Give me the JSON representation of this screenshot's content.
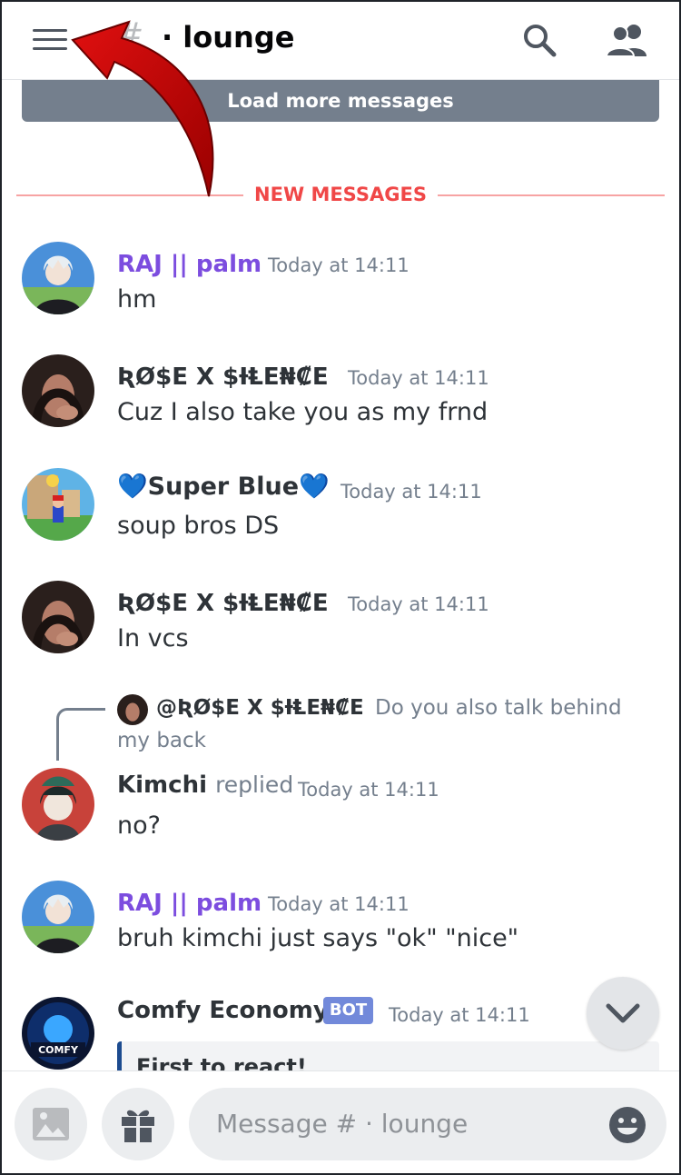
{
  "header": {
    "hash": "#",
    "channel": "· lounge"
  },
  "load_more": "Load more messages",
  "divider": "NEW MESSAGES",
  "messages": [
    {
      "author": "RAJ || palm",
      "time": "Today at 14:11",
      "text": "hm",
      "author_color": "#7c4ddf"
    },
    {
      "author": "ƦØ$E X $ƗⱠE₦₡E",
      "time": "Today at 14:11",
      "text": "Cuz I also take you as my frnd",
      "author_color": "#2e3338"
    },
    {
      "author": "💙Super Blue💙",
      "time": "Today at 14:11",
      "text": "soup bros DS",
      "author_color": "#2e3338"
    },
    {
      "author": "ƦØ$E X $ƗⱠE₦₡E",
      "time": "Today at 14:11",
      "text": "In vcs",
      "author_color": "#2e3338"
    },
    {
      "author": "Kimchi",
      "replied": "replied",
      "time": "Today at 14:11",
      "text": "no?",
      "author_color": "#2e3338"
    },
    {
      "author": "RAJ || palm",
      "time": "Today at 14:11",
      "text": "bruh kimchi just says \"ok\" \"nice\"",
      "author_color": "#7c4ddf"
    },
    {
      "author": "Comfy Economy",
      "bot": "BOT",
      "time": "Today at 14:11",
      "author_color": "#2e3338"
    }
  ],
  "reply_preview": {
    "author": "@ƦØ$E X $ƗⱠE₦₡E",
    "text_line1": "Do you also talk behind",
    "text_line2": "my back"
  },
  "embed": {
    "title": "First to react!"
  },
  "composer": {
    "placeholder": "Message # · lounge"
  },
  "colors": {
    "accent": "#7289da",
    "new_messages": "#f04747",
    "load_more_bg": "#747f8d"
  }
}
